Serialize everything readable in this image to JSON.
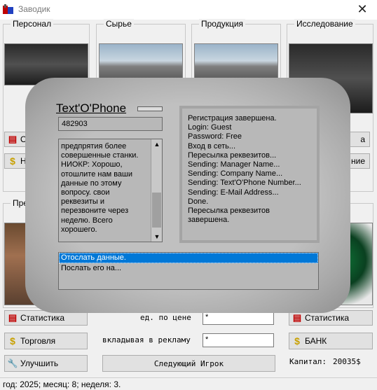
{
  "window": {
    "title": "Заводик",
    "close": "✕"
  },
  "groups": {
    "personnel": "Персонал",
    "raw": "Сырье",
    "products": "Продукция",
    "research": "Исследование",
    "sales": "Пре"
  },
  "left_buttons": {
    "stat_partial": "О",
    "hire_partial": "Н"
  },
  "right_buttons": {
    "top_partial": "а",
    "mid_partial": "ние"
  },
  "bottom_left": {
    "stats": "Статистика",
    "trade": "Торговля",
    "improve": "Улучшить"
  },
  "bottom_right": {
    "stats": "Статистика",
    "bank": "БАНК",
    "capital_label": "Капитал:",
    "capital_value": "20035$"
  },
  "center_bottom": {
    "price_label": "ед. по цене",
    "price_value": "*",
    "ads_label": "вкладывая в рекламу",
    "ads_value": "*",
    "next_player": "Следующий Игрок"
  },
  "status_bar": "год: 2025; месяц: 8; неделя: 3.",
  "modal": {
    "title": "Text'O'Phone",
    "code": "482903",
    "message": "предпрятия более\nсовершенные станки.\nНИОКР: Хорошо,\nотошлите нам ваши\nданные по этому\nвопросу. свои\nреквезиты и\nперезвоните через\nнеделю. Всего\nхорошего.",
    "log": [
      "Регистрация завершена.",
      "Login: Guest",
      "Password: Free",
      "Вход в сеть...",
      "Пересылка реквезитов...",
      "Sending: Manager Name...",
      "Sending: Company Name...",
      "Sending: Text'O'Phone Number...",
      "Sending: E-Mail Address...",
      "Done.",
      "Пересылка реквезитов",
      "завершена."
    ],
    "options": [
      "Отослать данные.",
      "Послать его на..."
    ]
  }
}
